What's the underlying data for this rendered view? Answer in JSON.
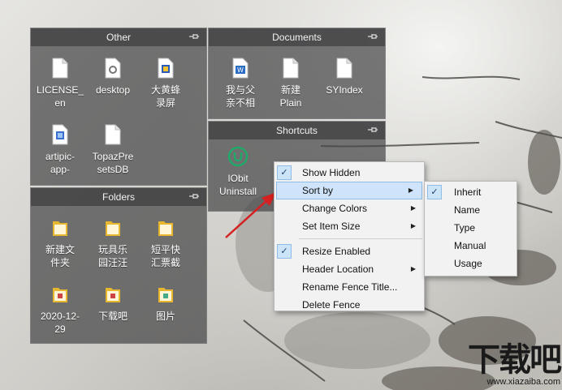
{
  "fences": {
    "other": {
      "title": "Other",
      "items": [
        {
          "label": "LICENSE_\nen",
          "icon": "text-file-icon"
        },
        {
          "label": "desktop",
          "icon": "settings-file-icon"
        },
        {
          "label": "大黄蜂\n录屏",
          "icon": "app-shortcut-icon"
        },
        {
          "label": "artipic-\napp-",
          "icon": "app-shortcut-icon"
        },
        {
          "label": "TopazPre\nsetsDB",
          "icon": "text-file-icon"
        }
      ]
    },
    "documents": {
      "title": "Documents",
      "items": [
        {
          "label": "我与父\n亲不相",
          "icon": "word-document-icon"
        },
        {
          "label": "新建\nPlain",
          "icon": "text-file-icon"
        },
        {
          "label": "SYIndex",
          "icon": "text-file-icon"
        }
      ]
    },
    "shortcuts": {
      "title": "Shortcuts",
      "items": [
        {
          "label": "IObit\nUninstall",
          "icon": "iobit-uninstaller-icon"
        }
      ]
    },
    "folders": {
      "title": "Folders",
      "items": [
        {
          "label": "新建文\n件夹",
          "icon": "folder-icon"
        },
        {
          "label": "玩具乐\n园汪汪",
          "icon": "folder-icon"
        },
        {
          "label": "短平快\n汇票截",
          "icon": "folder-icon"
        },
        {
          "label": "2020-12-\n29",
          "icon": "folder-icon"
        },
        {
          "label": "下载吧",
          "icon": "folder-icon"
        },
        {
          "label": "图片",
          "icon": "folder-icon"
        }
      ]
    }
  },
  "context_menu": {
    "items": [
      {
        "label": "Show Hidden",
        "checked": true
      },
      {
        "label": "Sort by",
        "submenu": true,
        "highlighted": true
      },
      {
        "label": "Change Colors",
        "submenu": true
      },
      {
        "label": "Set Item Size",
        "submenu": true
      },
      {
        "label": "Resize Enabled",
        "checked": true
      },
      {
        "label": "Header Location",
        "submenu": true
      },
      {
        "label": "Rename Fence Title..."
      },
      {
        "label": "Delete Fence"
      }
    ]
  },
  "sort_submenu": {
    "items": [
      {
        "label": "Inherit",
        "checked": true
      },
      {
        "label": "Name"
      },
      {
        "label": "Type"
      },
      {
        "label": "Manual"
      },
      {
        "label": "Usage"
      }
    ]
  },
  "watermark": {
    "brand": "下载吧",
    "url": "www.xiazaiba.com"
  },
  "colors": {
    "fence_bg": "#464648",
    "menu_bg": "#f2f2f2",
    "highlight": "#cfe4fa",
    "arrow": "#d42020",
    "iobit_green": "#1faa6a"
  }
}
